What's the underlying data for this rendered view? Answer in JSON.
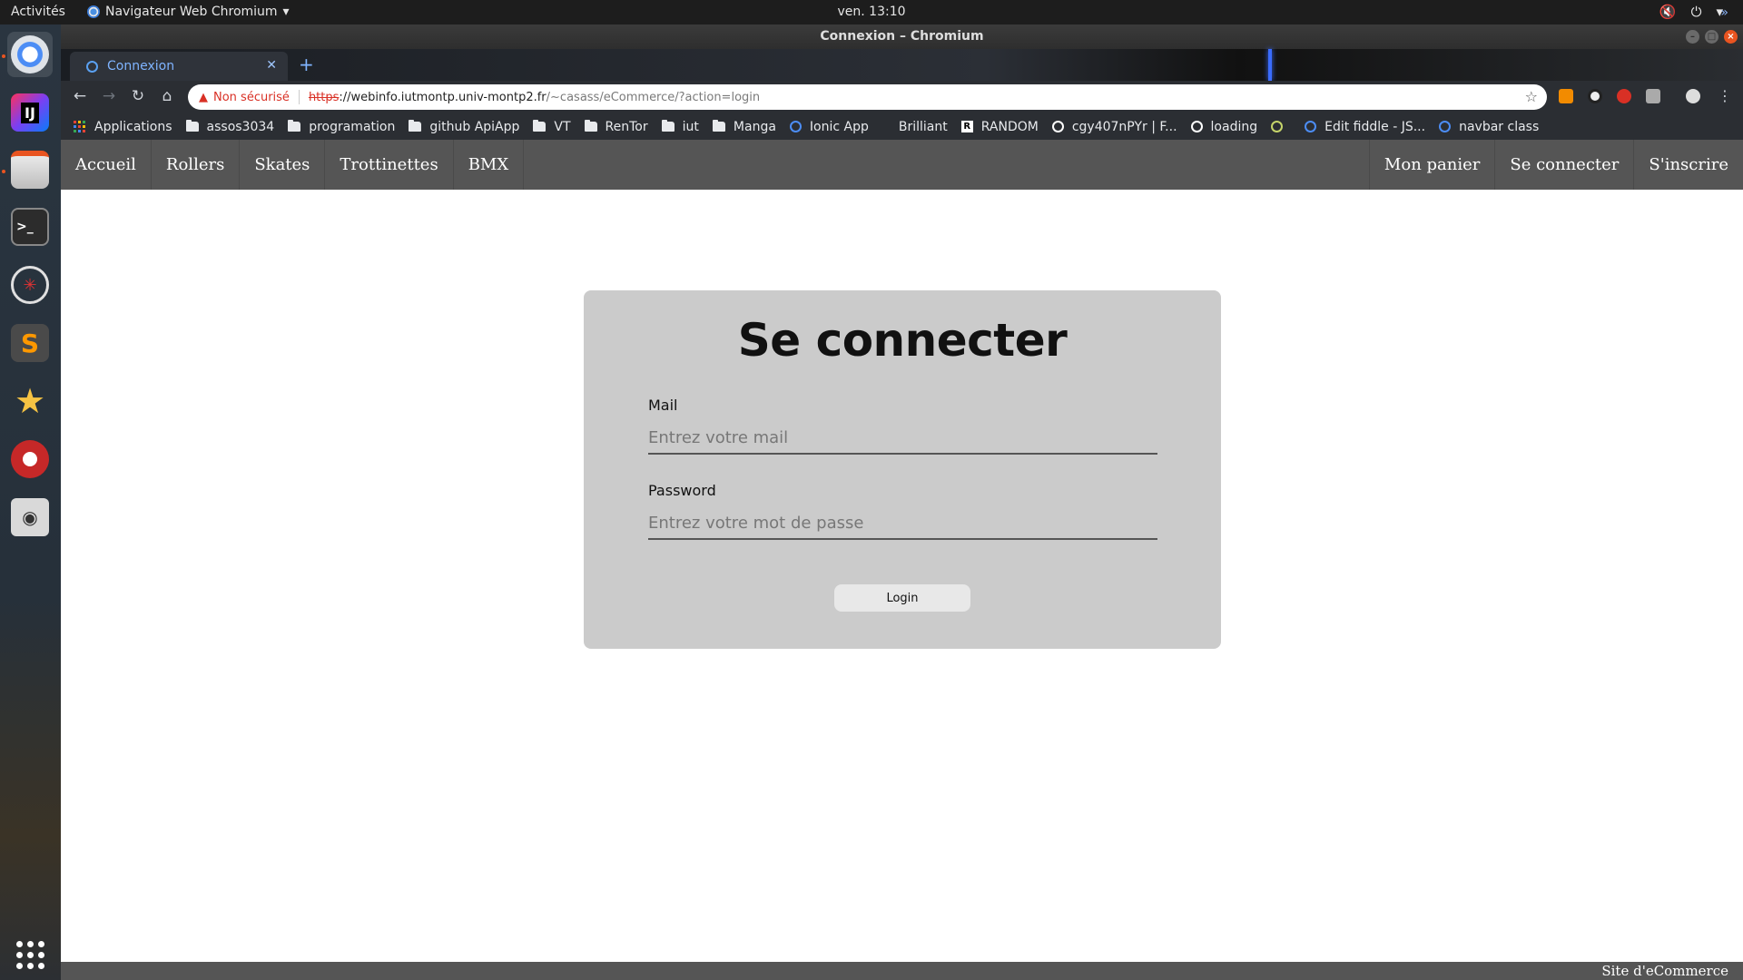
{
  "system_bar": {
    "activities": "Activités",
    "app_menu": "Navigateur Web Chromium",
    "clock": "ven. 13:10"
  },
  "window": {
    "title": "Connexion – Chromium"
  },
  "browser": {
    "tab": {
      "title": "Connexion"
    },
    "new_tab_label": "+",
    "omnibox": {
      "security_label": "Non sécurisé",
      "protocol": "https",
      "host": "://webinfo.iutmontp.univ-montp2.fr",
      "path": "/~casass/eCommerce/?action=login"
    },
    "bookmarks": [
      {
        "label": "Applications",
        "kind": "apps"
      },
      {
        "label": "assos3034",
        "kind": "folder"
      },
      {
        "label": "programation",
        "kind": "folder"
      },
      {
        "label": "github ApiApp",
        "kind": "folder"
      },
      {
        "label": "VT",
        "kind": "folder"
      },
      {
        "label": "RenTor",
        "kind": "folder"
      },
      {
        "label": "iut",
        "kind": "folder"
      },
      {
        "label": "Manga",
        "kind": "folder"
      },
      {
        "label": "Ionic App",
        "kind": "site"
      },
      {
        "label": "Brilliant",
        "kind": "site"
      },
      {
        "label": "RANDOM",
        "kind": "site"
      },
      {
        "label": "cgy407nPYr | F...",
        "kind": "site"
      },
      {
        "label": "loading",
        "kind": "site"
      },
      {
        "label": "",
        "kind": "site"
      },
      {
        "label": "Edit fiddle - JS...",
        "kind": "site"
      },
      {
        "label": "navbar class",
        "kind": "site"
      }
    ],
    "bookmarks_more": "»"
  },
  "site": {
    "nav_left": [
      "Accueil",
      "Rollers",
      "Skates",
      "Trottinettes",
      "BMX"
    ],
    "nav_right": [
      "Mon panier",
      "Se connecter",
      "S'inscrire"
    ],
    "login": {
      "title": "Se connecter",
      "mail_label": "Mail",
      "mail_placeholder": "Entrez votre mail",
      "password_label": "Password",
      "password_placeholder": "Entrez votre mot de passe",
      "submit_label": "Login"
    },
    "footer": "Site d'eCommerce"
  },
  "colors": {
    "nav_bg": "#555555",
    "card_bg": "#cbcbcb",
    "accent_ubuntu": "#e95420",
    "insecure_red": "#d93025"
  }
}
